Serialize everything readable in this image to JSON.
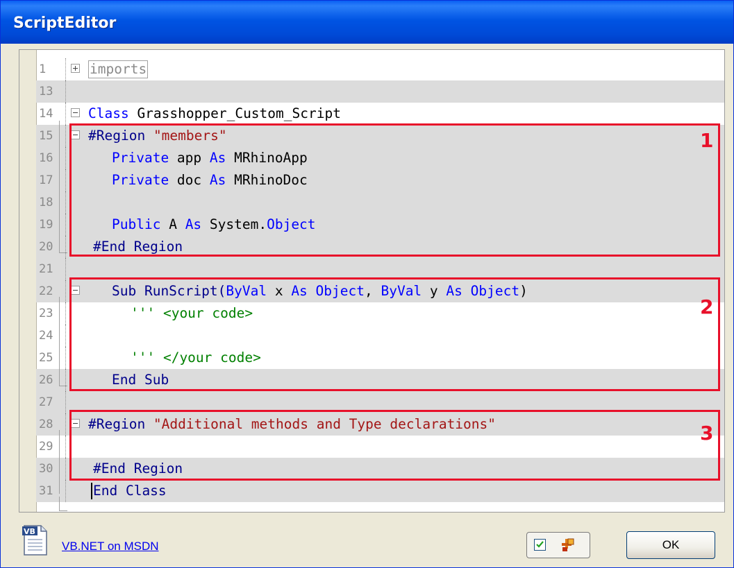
{
  "window": {
    "title": "ScriptEditor"
  },
  "editor": {
    "lines": [
      {
        "num": "1",
        "collapsed_label": "imports"
      },
      {
        "num": "13"
      },
      {
        "num": "14",
        "kw": "Class",
        "text": " Grasshopper_Custom_Script"
      },
      {
        "num": "15",
        "kw": "#Region",
        "str": "\"members\""
      },
      {
        "num": "16",
        "a": "Private",
        "b": " app ",
        "c": "As",
        "d": " MRhinoApp"
      },
      {
        "num": "17",
        "a": "Private",
        "b": " doc ",
        "c": "As",
        "d": " MRhinoDoc"
      },
      {
        "num": "18"
      },
      {
        "num": "19",
        "a": "Public",
        "b": " A ",
        "c": "As",
        "d": " System.",
        "e": "Object"
      },
      {
        "num": "20",
        "kw": "#End Region"
      },
      {
        "num": "21"
      },
      {
        "num": "22",
        "a": "Sub RunScript(",
        "b": "ByVal",
        "c": " x ",
        "d": "As",
        "e": " Object",
        "f": ", ",
        "g": "ByVal",
        "h": " y ",
        "i": "As",
        "j": " Object",
        "k": ")"
      },
      {
        "num": "23",
        "com": "''' <your code>"
      },
      {
        "num": "24"
      },
      {
        "num": "25",
        "com": "''' </your code>"
      },
      {
        "num": "26",
        "kw": "End Sub"
      },
      {
        "num": "27"
      },
      {
        "num": "28",
        "kw": "#Region",
        "str": " \"Additional methods and Type declarations\""
      },
      {
        "num": "29"
      },
      {
        "num": "30",
        "kw": "#End Region"
      },
      {
        "num": "31",
        "kw": "End Class"
      }
    ]
  },
  "annotations": {
    "box1": "1",
    "box2": "2",
    "box3": "3"
  },
  "footer": {
    "icon_label": "VB",
    "link": "VB.NET on MSDN",
    "ok": "OK"
  },
  "colors": {
    "keyword": "#0000ff",
    "string": "#a31515",
    "comment": "#008000",
    "annotation": "#e8102a"
  }
}
